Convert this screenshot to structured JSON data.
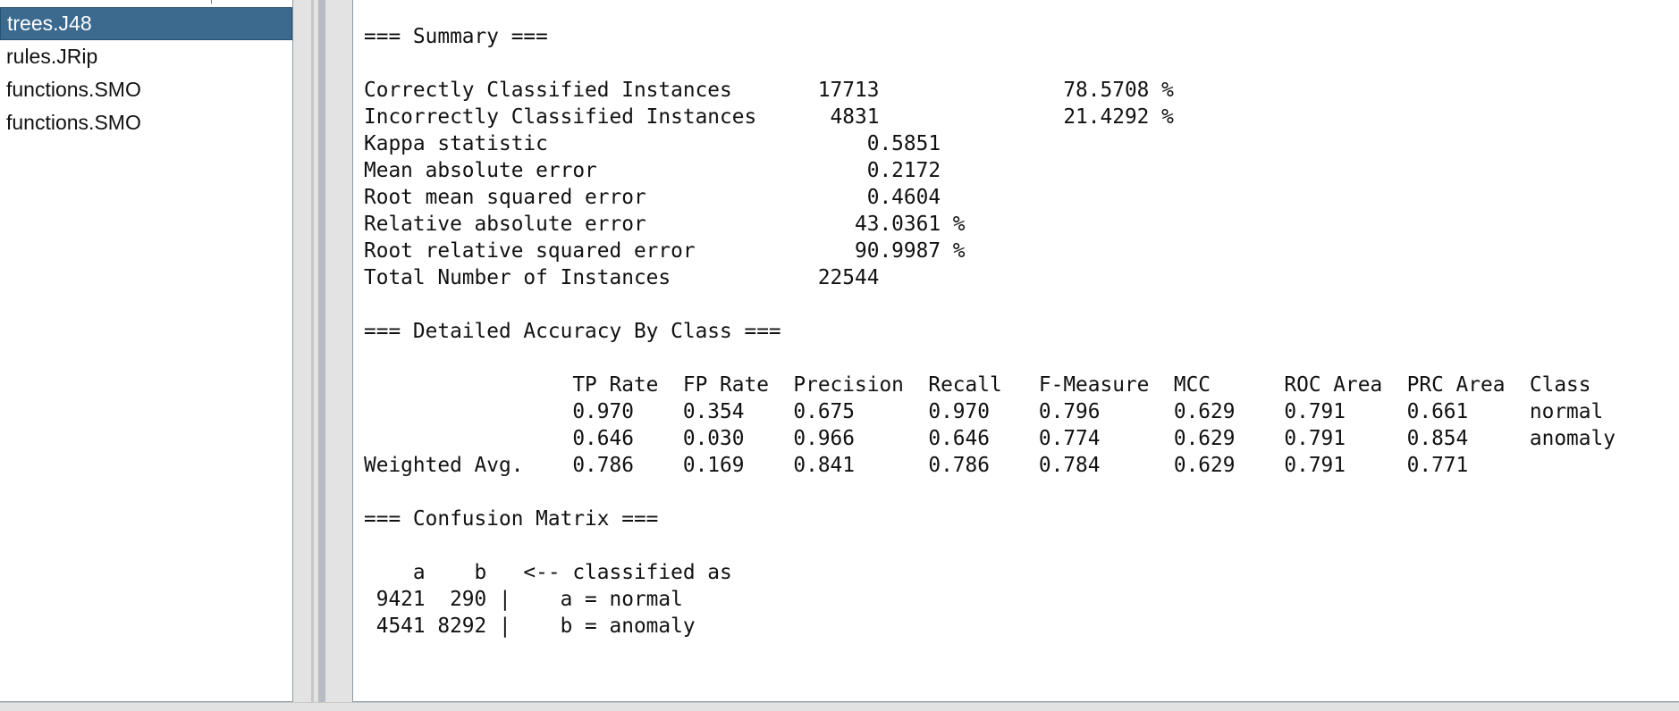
{
  "result_list": {
    "items": [
      {
        "label": "trees.J48",
        "selected": true
      },
      {
        "label": "rules.JRip",
        "selected": false
      },
      {
        "label": "functions.SMO",
        "selected": false
      },
      {
        "label": "functions.SMO",
        "selected": false
      }
    ]
  },
  "output": {
    "text": "=== Summary ===\n\nCorrectly Classified Instances       17713               78.5708 %\nIncorrectly Classified Instances      4831               21.4292 %\nKappa statistic                          0.5851\nMean absolute error                      0.2172\nRoot mean squared error                  0.4604\nRelative absolute error                 43.0361 %\nRoot relative squared error             90.9987 %\nTotal Number of Instances            22544     \n\n=== Detailed Accuracy By Class ===\n\n                 TP Rate  FP Rate  Precision  Recall   F-Measure  MCC      ROC Area  PRC Area  Class\n                 0.970    0.354    0.675      0.970    0.796      0.629    0.791     0.661     normal\n                 0.646    0.030    0.966      0.646    0.774      0.629    0.791     0.854     anomaly\nWeighted Avg.    0.786    0.169    0.841      0.786    0.784      0.629    0.791     0.771     \n\n=== Confusion Matrix ===\n\n    a    b   <-- classified as\n 9421  290 |    a = normal\n 4541 8292 |    b = anomaly"
  }
}
